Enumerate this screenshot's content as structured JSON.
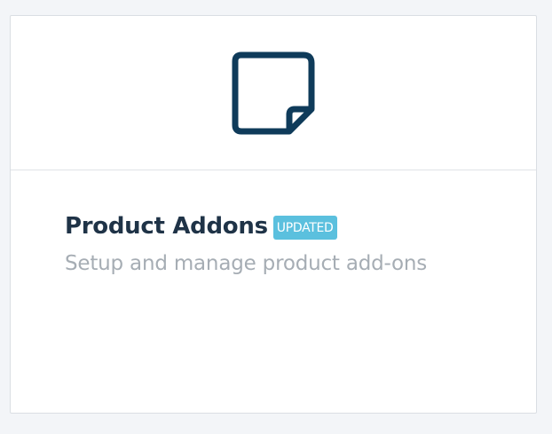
{
  "card": {
    "icon": "sticky-note-icon",
    "title": "Product Addons",
    "badge": "UPDATED",
    "description": "Setup and manage product add-ons"
  },
  "colors": {
    "icon": "#0f3b5a",
    "title": "#1f3347",
    "badge_bg": "#5bc0de",
    "description": "#a6adb4"
  }
}
